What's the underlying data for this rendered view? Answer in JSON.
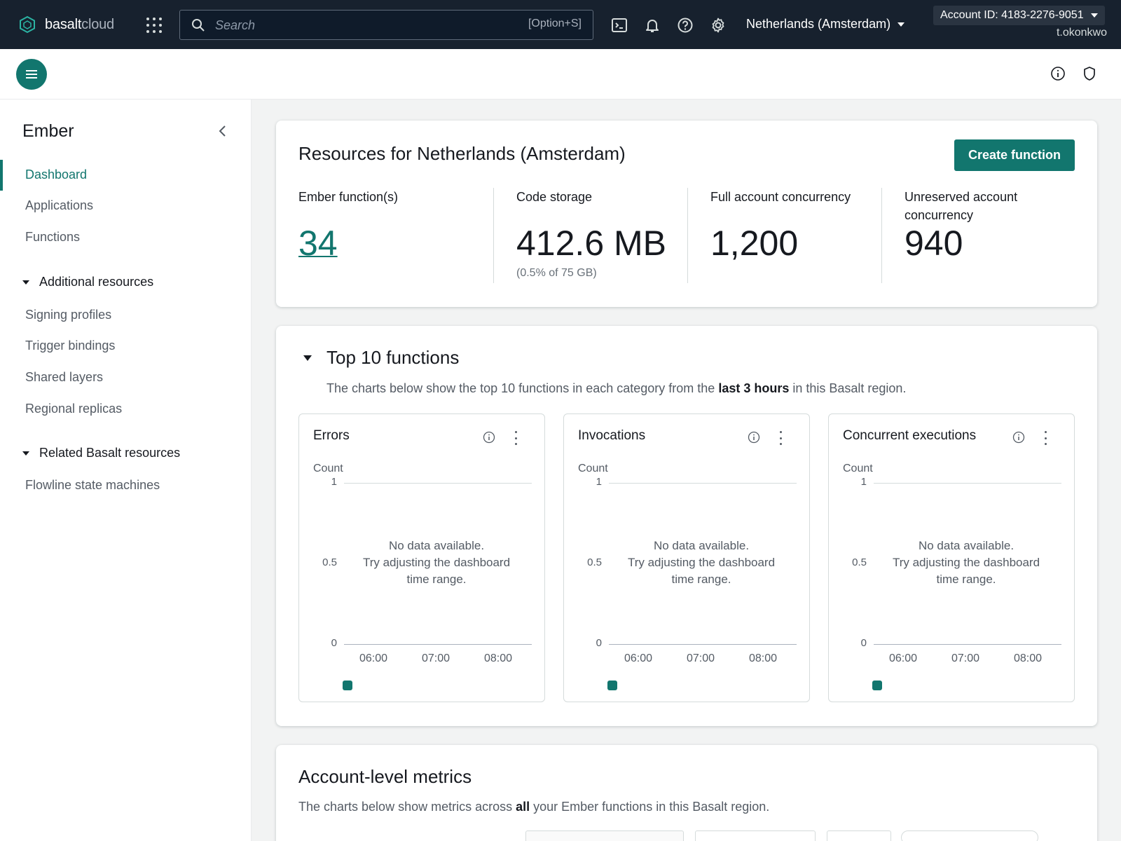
{
  "topnav": {
    "logo_main": "basalt",
    "logo_accent": "cloud",
    "search_placeholder": "Search",
    "search_shortcut": "[Option+S]",
    "region": "Netherlands (Amsterdam)",
    "account": "Account ID: 4183-2276-9051",
    "user": "t.okonkwo"
  },
  "sidebar": {
    "title": "Ember",
    "items": [
      {
        "label": "Dashboard",
        "active": true
      },
      {
        "label": "Applications"
      },
      {
        "label": "Functions"
      }
    ],
    "groups": [
      {
        "label": "Additional resources",
        "items": [
          {
            "label": "Signing profiles"
          },
          {
            "label": "Trigger bindings"
          },
          {
            "label": "Shared layers"
          },
          {
            "label": "Regional replicas"
          }
        ]
      },
      {
        "label": "Related Basalt resources",
        "items": [
          {
            "label": "Flowline state machines"
          }
        ]
      }
    ]
  },
  "resources": {
    "title": "Resources for Netherlands (Amsterdam)",
    "create_button": "Create function",
    "stats": [
      {
        "label": "Ember function(s)",
        "value": "34"
      },
      {
        "label": "Code storage",
        "value": "412.6 MB",
        "sub": "(0.5% of 75 GB)"
      },
      {
        "label": "Full account concurrency",
        "value": "1,200"
      },
      {
        "label": "Unreserved account concurrency",
        "value": "940"
      }
    ]
  },
  "top10": {
    "title": "Top 10 functions",
    "desc_pre": "The charts below show the top 10 functions in each category from the ",
    "desc_bold": "last 3 hours",
    "desc_post": " in this Basalt region.",
    "charts": [
      {
        "title": "Errors"
      },
      {
        "title": "Invocations"
      },
      {
        "title": "Concurrent executions"
      }
    ],
    "y_label": "Count",
    "y_ticks": [
      "1",
      "0.5",
      "0"
    ],
    "x_ticks": [
      "06:00",
      "07:00",
      "08:00"
    ],
    "nodata_line1": "No data available.",
    "nodata_line2": "Try adjusting the dashboard time range."
  },
  "account_metrics": {
    "title": "Account-level metrics",
    "desc_pre": "The charts below show metrics across ",
    "desc_bold": "all",
    "desc_post": " your Ember functions in this Basalt region."
  },
  "colors": {
    "accent": "#12766e",
    "nav_bg": "#17212e"
  },
  "chart_data": [
    {
      "type": "line",
      "title": "Errors",
      "ylabel": "Count",
      "ylim": [
        0,
        1
      ],
      "x": [
        "06:00",
        "07:00",
        "08:00"
      ],
      "series": []
    },
    {
      "type": "line",
      "title": "Invocations",
      "ylabel": "Count",
      "ylim": [
        0,
        1
      ],
      "x": [
        "06:00",
        "07:00",
        "08:00"
      ],
      "series": []
    },
    {
      "type": "line",
      "title": "Concurrent executions",
      "ylabel": "Count",
      "ylim": [
        0,
        1
      ],
      "x": [
        "06:00",
        "07:00",
        "08:00"
      ],
      "series": []
    }
  ]
}
